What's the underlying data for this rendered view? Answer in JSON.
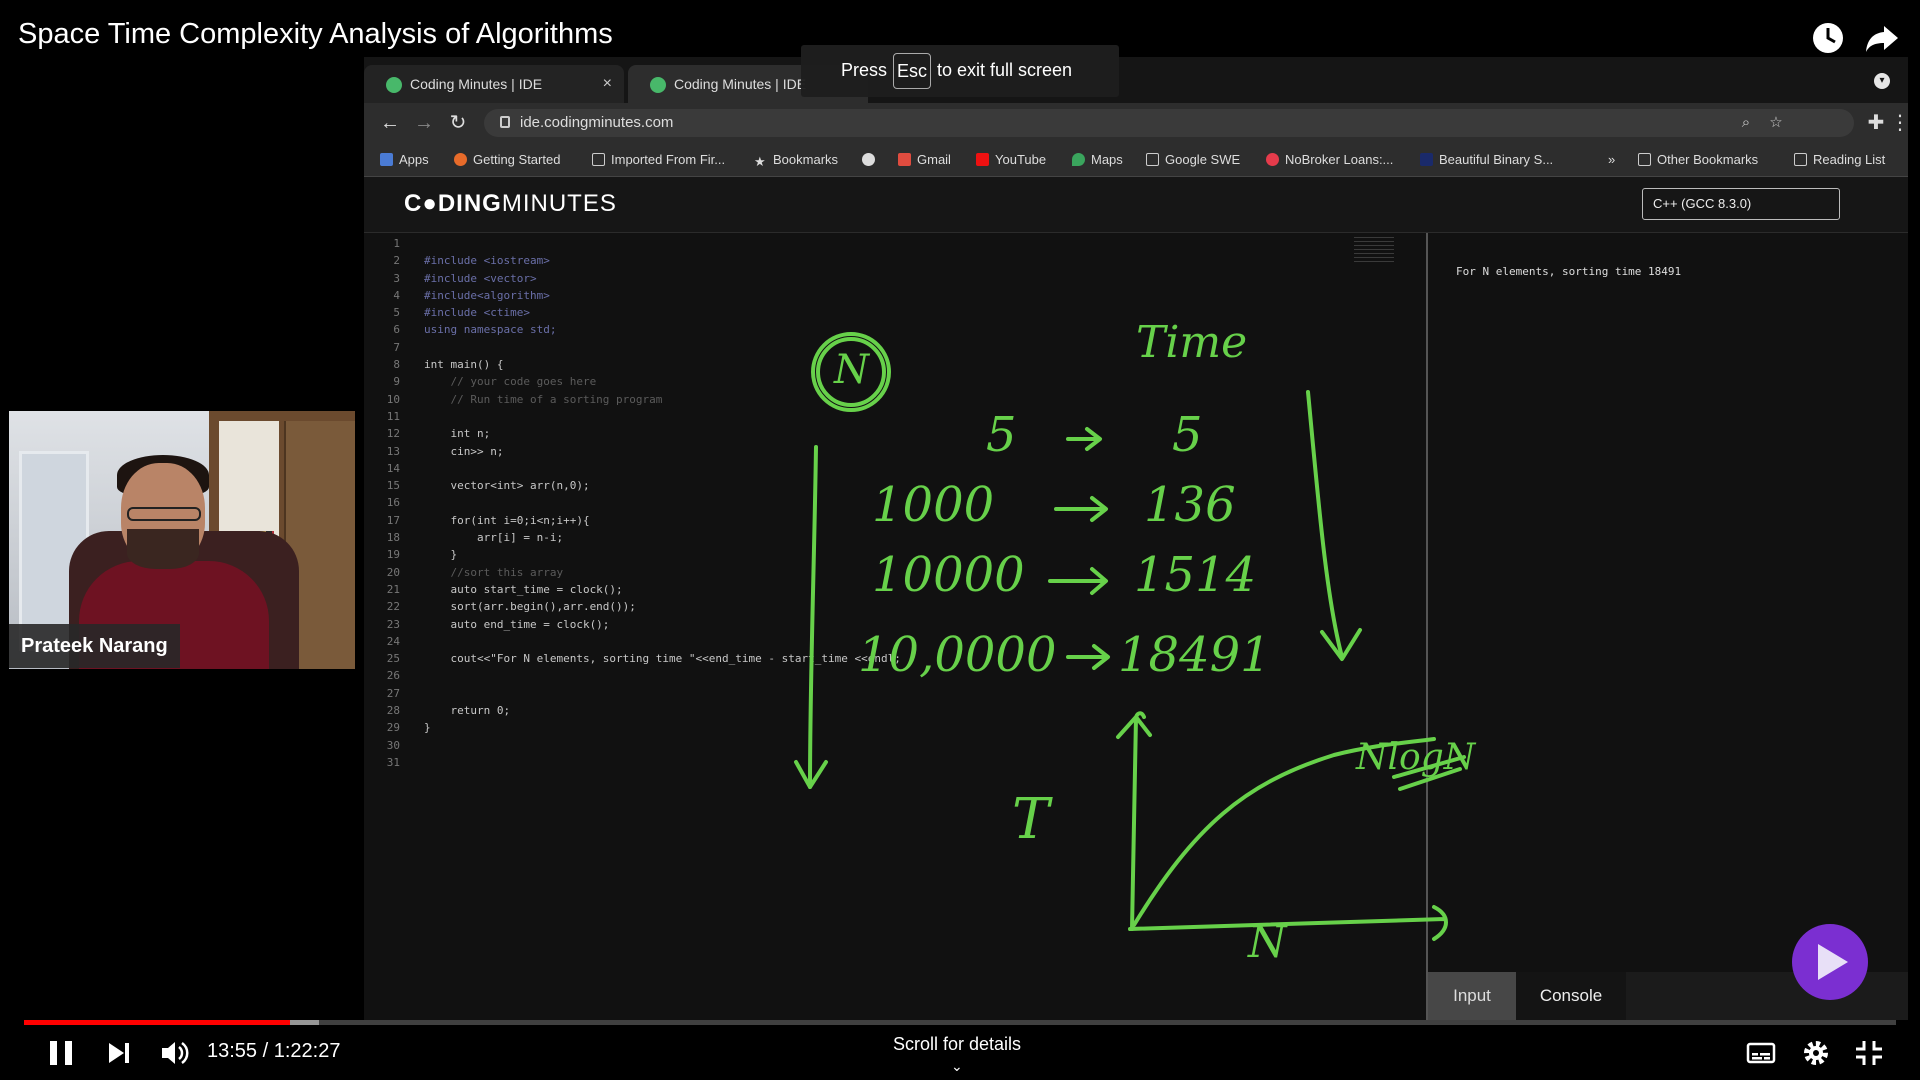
{
  "player": {
    "title": "Space Time Complexity Analysis of Algorithms",
    "current_time": "13:55",
    "duration": "1:22:27",
    "time_text": "13:55 / 1:22:27",
    "progress_fraction": 0.1419,
    "buffered_fraction": 0.1574,
    "scroll_hint": "Scroll for details",
    "controls": [
      "pause-icon",
      "next-icon",
      "volume-icon",
      "subtitles-icon",
      "settings-icon",
      "exit-fullscreen-icon"
    ],
    "top_icons": [
      "watch-later-icon",
      "share-icon"
    ],
    "accent_color": "#ff0000"
  },
  "presenter": {
    "name": "Prateek Narang"
  },
  "fullscreen_toast": {
    "press": "Press",
    "key": "Esc",
    "rest": "to exit full screen"
  },
  "browser": {
    "tabs": [
      {
        "label": "Coding Minutes | IDE"
      },
      {
        "label": "Coding Minutes | IDE"
      }
    ],
    "url": "ide.codingminutes.com",
    "bookmarks": [
      "Apps",
      "Getting Started",
      "Imported From Fir...",
      "Bookmarks",
      "Gmail",
      "YouTube",
      "Maps",
      "Google SWE",
      "NoBroker Loans:...",
      "Beautiful Binary S...",
      "»",
      "Other Bookmarks",
      "Reading List"
    ]
  },
  "ide": {
    "logo_bold": "C●DING",
    "logo_light": "MINUTES",
    "language": "C++ (GCC 8.3.0)",
    "code_lines": [
      "",
      "#include <iostream>",
      "#include <vector>",
      "#include<algorithm>",
      "#include <ctime>",
      "using namespace std;",
      "",
      "int main() {",
      "    // your code goes here",
      "    // Run time of a sorting program",
      "",
      "    int n;",
      "    cin>> n;",
      "",
      "    vector<int> arr(n,0);",
      "",
      "    for(int i=0;i<n;i++){",
      "        arr[i] = n-i;",
      "    }",
      "    //sort this array",
      "    auto start_time = clock();",
      "    sort(arr.begin(),arr.end());",
      "    auto end_time = clock();",
      "",
      "    cout<<\"For N elements, sorting time \"<<end_time - start_time <<endl;",
      "",
      "",
      "    return 0;",
      "}",
      "",
      ""
    ],
    "output": "For N elements, sorting time 18491",
    "tabs": {
      "input": "Input",
      "console": "Console"
    }
  },
  "annotation": {
    "n_label": "N",
    "time_label": "Time",
    "rows": [
      {
        "n": "5",
        "t": "5"
      },
      {
        "n": "1000",
        "t": "136"
      },
      {
        "n": "10000",
        "t": "1514"
      },
      {
        "n": "10,0000",
        "t": "18491"
      }
    ],
    "graph_y": "T",
    "graph_x": "N",
    "curve_label": "NlogN",
    "ink_color": "#67d14a"
  }
}
